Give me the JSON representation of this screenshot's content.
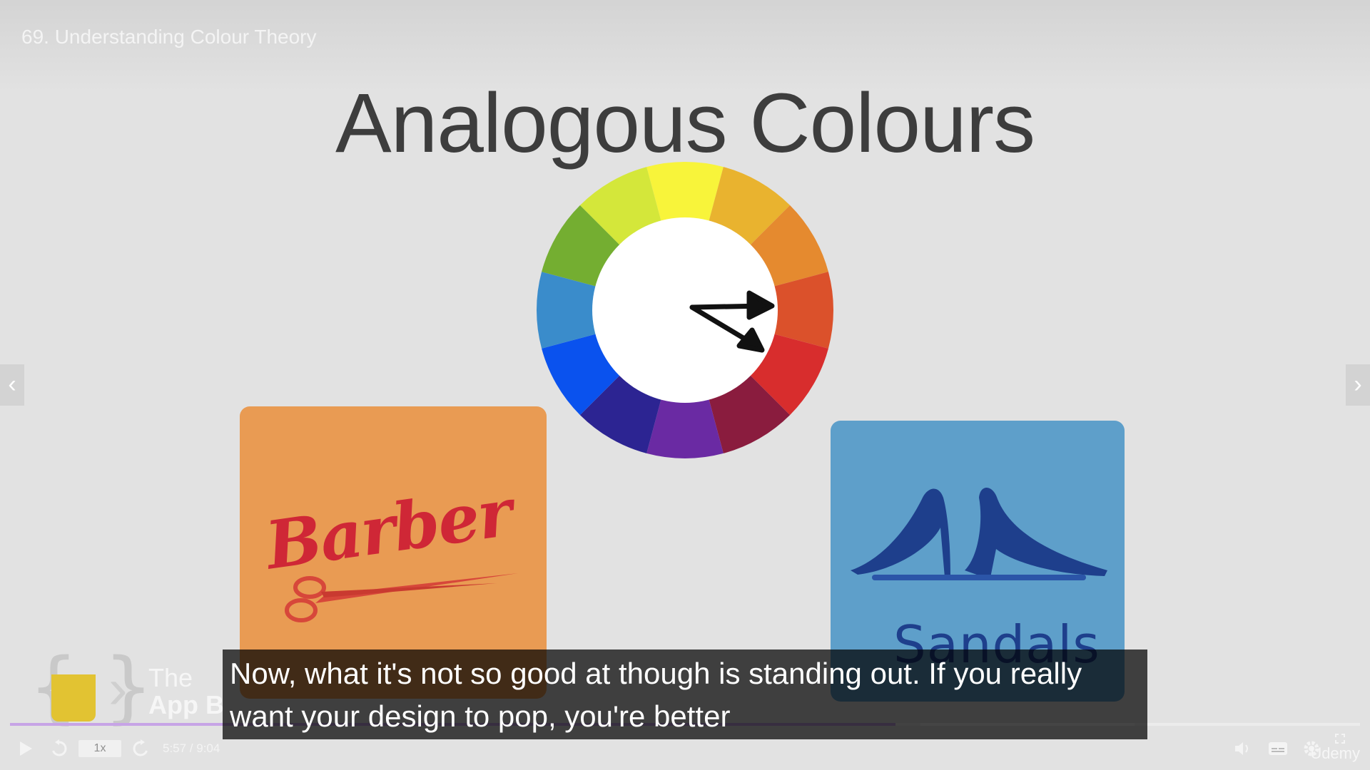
{
  "lecture": {
    "title": "69. Understanding Colour Theory"
  },
  "slide": {
    "title": "Analogous Colours",
    "wheel_colors": [
      "#f8f43a",
      "#e9b32f",
      "#e58a2f",
      "#db512b",
      "#d82d2d",
      "#8a1c3e",
      "#6a2aa3",
      "#2c2492",
      "#0a52ee",
      "#3a8ccb",
      "#74ae31",
      "#d4e73a"
    ],
    "barber_card": {
      "color": "#e99b53",
      "text": "Barber",
      "text_color": "#cf2736"
    },
    "sandals_card": {
      "color": "#5e9fca",
      "text": "Sandals",
      "text_color": "#1e3f8c"
    }
  },
  "logo": {
    "line1": "The",
    "line2": "App B"
  },
  "caption": {
    "line1": "Now, what it's not so good at though is standing out. If you really",
    "line2": "want your design to pop, you're better"
  },
  "player": {
    "speed_label": "1x",
    "time": "5:57 / 9:04",
    "progress": 0.656,
    "brand": "Udemy",
    "prev_icon": "chevron-left-icon",
    "next_icon": "chevron-right-icon"
  }
}
